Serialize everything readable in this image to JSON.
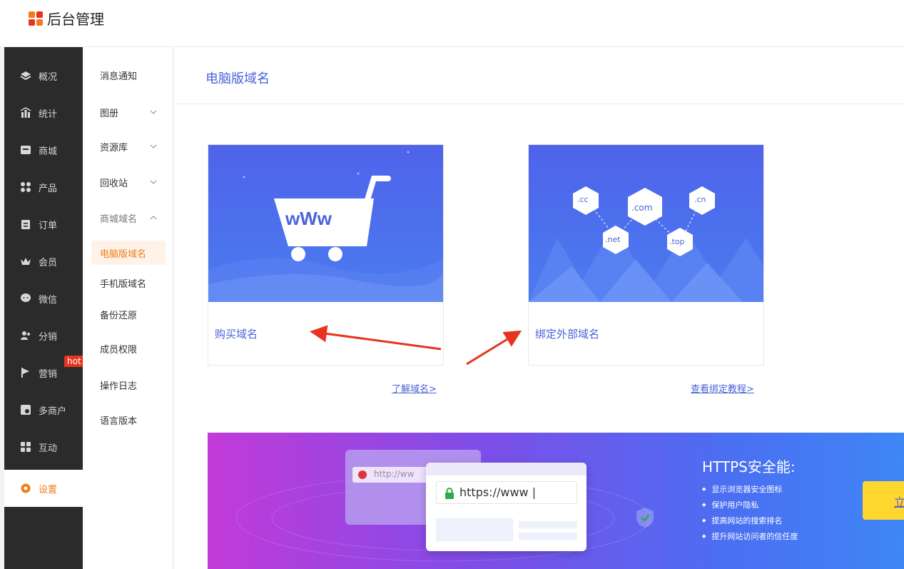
{
  "app": {
    "title": "后台管理"
  },
  "sidebar": {
    "items": [
      {
        "label": "概况",
        "icon": "layers-icon"
      },
      {
        "label": "统计",
        "icon": "chart-icon"
      },
      {
        "label": "商城",
        "icon": "store-icon"
      },
      {
        "label": "产品",
        "icon": "grid-icon"
      },
      {
        "label": "订单",
        "icon": "clipboard-icon"
      },
      {
        "label": "会员",
        "icon": "crown-icon"
      },
      {
        "label": "微信",
        "icon": "chat-icon"
      },
      {
        "label": "分销",
        "icon": "users-icon"
      },
      {
        "label": "营销",
        "icon": "flag-icon"
      },
      {
        "label": "多商户",
        "icon": "shop-icon"
      },
      {
        "label": "互动",
        "icon": "apps-icon"
      },
      {
        "label": "设置",
        "icon": "gear-icon"
      }
    ],
    "hot_badge": "hot",
    "accent": "#f07c1b"
  },
  "subnav": {
    "items": [
      {
        "label": "消息通知"
      },
      {
        "label": "图册"
      },
      {
        "label": "资源库"
      },
      {
        "label": "回收站"
      },
      {
        "label": "商城域名"
      },
      {
        "label": "电脑版域名"
      },
      {
        "label": "手机版域名"
      },
      {
        "label": "备份还原"
      },
      {
        "label": "成员权限"
      },
      {
        "label": "操作日志"
      },
      {
        "label": "语言版本"
      }
    ]
  },
  "main": {
    "title": "电脑版域名",
    "cards": [
      {
        "label": "购买域名",
        "link": "了解域名>",
        "art_text": "wWw"
      },
      {
        "label": "绑定外部域名",
        "link": "查看绑定教程>",
        "tlds": [
          ".cc",
          ".com",
          ".cn",
          ".net",
          ".top"
        ]
      }
    ],
    "banner": {
      "title": "HTTPS安全能:",
      "points": [
        "显示浏览器安全图标",
        "保护用户隐私",
        "提高网站的搜索排名",
        "提升网站访问者的信任度"
      ],
      "http_text": "http://ww",
      "https_text": "https://www |",
      "button": "立"
    }
  },
  "colors": {
    "link": "#4a63d8",
    "sidebar_bg": "#2b2b2b",
    "arrow": "#e8341e"
  }
}
